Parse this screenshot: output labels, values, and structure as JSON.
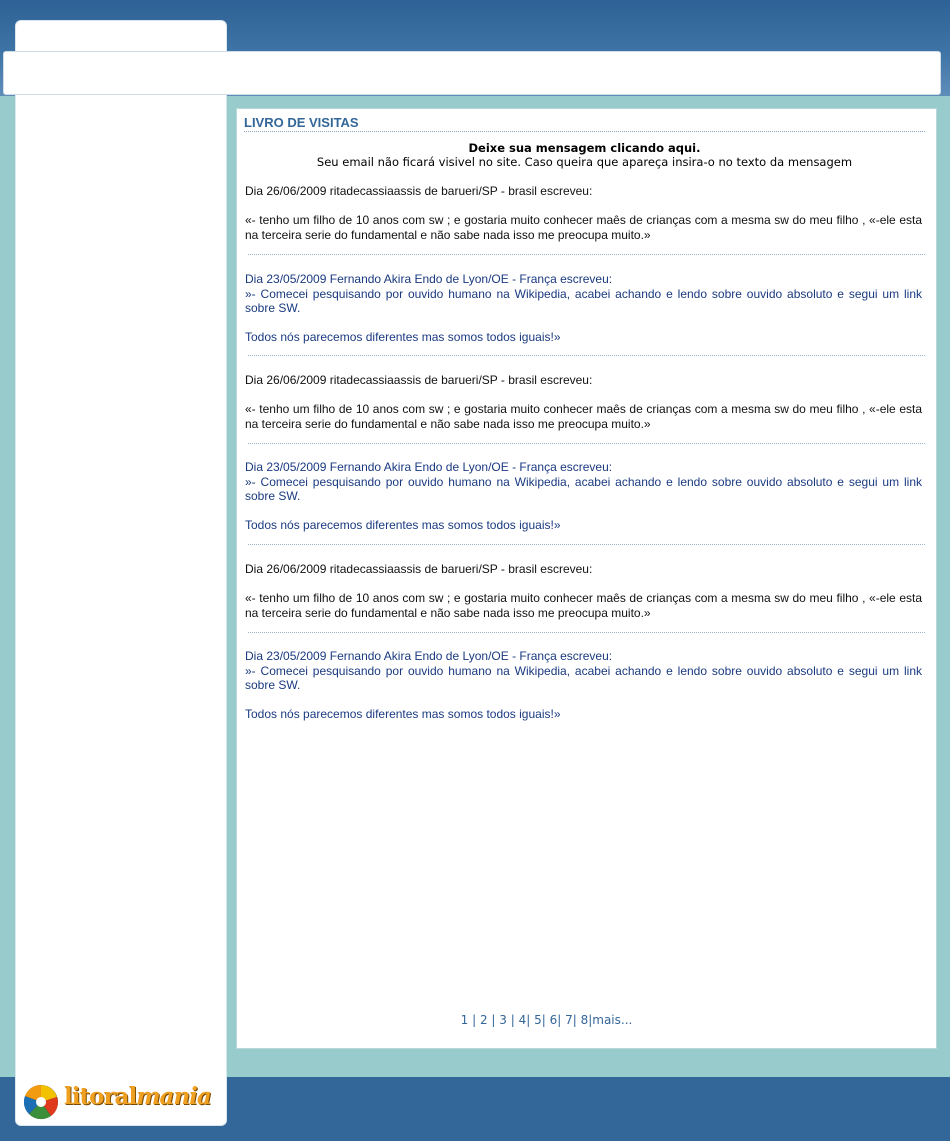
{
  "guestbook": {
    "title": "LIVRO DE VISITAS",
    "cta": "Deixe sua mensagem clicando aqui.",
    "note": "Seu email não ficará visivel no site. Caso queira que apareça insira-o no texto da mensagem"
  },
  "entries": [
    {
      "header": "Dia 26/06/2009   ritadecassiaassis de barueri/SP - brasil escreveu:",
      "body": "«- tenho um filho de 10 anos com sw ; e gostaria muito conhecer maês de crianças com a mesma sw do meu filho , «-ele esta na terceira serie do fundamental e não sabe nada isso me preocupa muito.»"
    },
    {
      "header": "Dia 23/05/2009  Fernando Akira Endo de Lyon/OE - França escreveu:",
      "body": "»- Comecei pesquisando por ouvido humano na Wikipedia, acabei achando e lendo sobre ouvido absoluto e segui um link sobre SW.",
      "extra": "Todos nós parecemos diferentes mas somos todos iguais!»"
    },
    {
      "header": "Dia 26/06/2009   ritadecassiaassis de barueri/SP - brasil escreveu:",
      "body": "«- tenho um filho de 10 anos com sw ; e gostaria muito conhecer maês de crianças com a mesma sw do meu filho , «-ele esta na terceira serie do fundamental e não sabe nada isso me preocupa muito.»"
    },
    {
      "header": "Dia 23/05/2009  Fernando Akira Endo de Lyon/OE - França escreveu:",
      "body": "»- Comecei pesquisando por ouvido humano na Wikipedia, acabei achando e lendo sobre ouvido absoluto e segui um link sobre SW.",
      "extra": "Todos nós parecemos diferentes mas somos todos iguais!»"
    },
    {
      "header": "Dia 26/06/2009   ritadecassiaassis de barueri/SP - brasil escreveu:",
      "body": "«- tenho um filho de 10 anos com sw ; e gostaria muito conhecer maês de crianças com a mesma sw do meu filho , «-ele esta na terceira serie do fundamental e não sabe nada isso me preocupa muito.»"
    },
    {
      "header": "Dia 23/05/2009  Fernando Akira Endo de Lyon/OE - França escreveu:",
      "body": "»- Comecei pesquisando por ouvido humano na Wikipedia, acabei achando e lendo sobre ouvido absoluto e segui um link sobre SW.",
      "extra": "Todos nós parecemos diferentes mas somos todos iguais!»"
    }
  ],
  "pagination": {
    "p1": "1",
    "s1": " | ",
    "p2": "2",
    "s2": " | ",
    "p3": "3",
    "s3": " | ",
    "p4": "4",
    "s4": "| ",
    "p5": "5",
    "s5": "| ",
    "p6": "6",
    "s6": "| ",
    "p7": "7",
    "s7": "| ",
    "p8": "8",
    "s8": "|",
    "more": "mais..."
  },
  "brand": {
    "logo_part1": "litoral",
    "logo_part2": "mania"
  },
  "colors": {
    "title": "#336699",
    "link_blue": "#1a3a80",
    "band": "#336699",
    "background": "#98cbcc"
  }
}
